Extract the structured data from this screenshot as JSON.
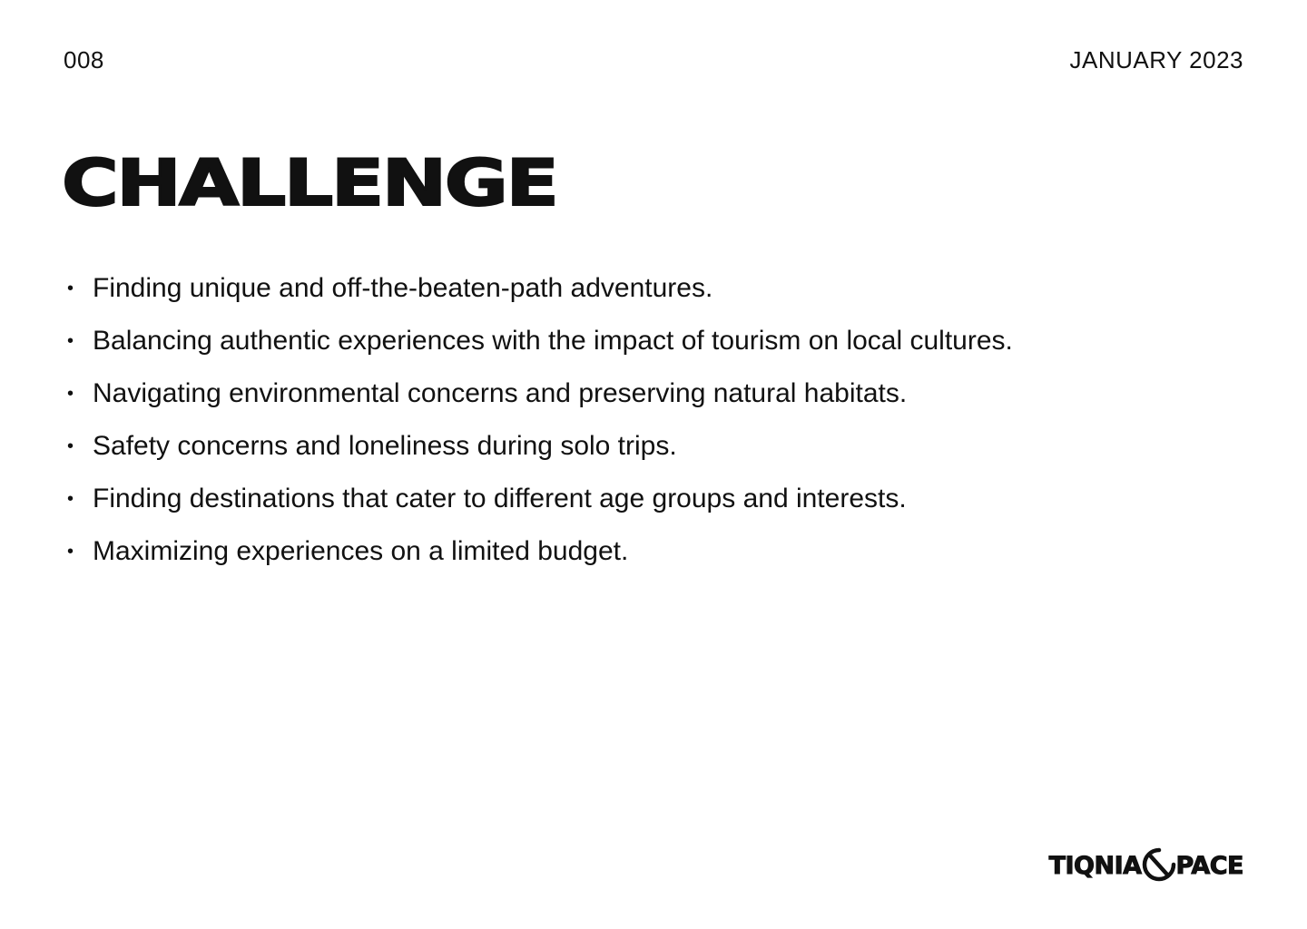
{
  "header": {
    "page_number": "008",
    "date": "JANUARY 2023"
  },
  "title": "CHALLENGE",
  "challenges": [
    "Finding unique and off-the-beaten-path adventures.",
    "Balancing authentic experiences with the impact of tourism on local cultures.",
    "Navigating environmental concerns and preserving natural habitats.",
    "Safety concerns and loneliness during solo trips.",
    "Finding destinations that cater to different age groups and interests.",
    "Maximizing experiences on a limited budget."
  ],
  "logo": {
    "left_text": "TIQNIA",
    "right_text": "PACE",
    "mark_icon": "s-swirl-icon"
  },
  "colors": {
    "text": "#111111",
    "background": "#ffffff"
  }
}
